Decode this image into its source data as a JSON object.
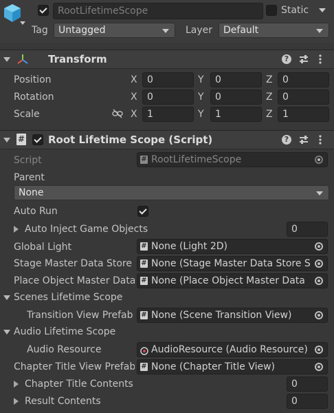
{
  "gameobject": {
    "active": true,
    "name": "RootLifetimeScope",
    "static_label": "Static",
    "static": false,
    "tag_label": "Tag",
    "tag_value": "Untagged",
    "layer_label": "Layer",
    "layer_value": "Default"
  },
  "transform": {
    "title": "Transform",
    "rows": [
      {
        "label": "Position",
        "x": "0",
        "y": "0",
        "z": "0"
      },
      {
        "label": "Rotation",
        "x": "0",
        "y": "0",
        "z": "0"
      },
      {
        "label": "Scale",
        "x": "1",
        "y": "1",
        "z": "1"
      }
    ],
    "axis": {
      "x": "X",
      "y": "Y",
      "z": "Z"
    }
  },
  "script_component": {
    "title": "Root Lifetime Scope (Script)",
    "enabled": true,
    "script_label": "Script",
    "script_value": "RootLifetimeScope",
    "parent_label": "Parent",
    "parent_value": "None",
    "auto_run_label": "Auto Run",
    "auto_run": true,
    "auto_inject_label": "Auto Inject Game Objects",
    "auto_inject_count": "0",
    "global_light_label": "Global Light",
    "global_light_value": "None (Light 2D)",
    "stage_master_label": "Stage Master Data Store",
    "stage_master_value": "None (Stage Master Data Store S",
    "place_object_label": "Place Object Master Data",
    "place_object_value": "None (Place Object Master Data",
    "scenes_scope_label": "Scenes Lifetime Scope",
    "transition_view_label": "Transition View Prefab",
    "transition_view_value": "None (Scene Transition View)",
    "audio_scope_label": "Audio Lifetime Scope",
    "audio_resource_label": "Audio Resource",
    "audio_resource_value": "AudioResource (Audio Resource)",
    "chapter_title_view_label": "Chapter Title View Prefab",
    "chapter_title_view_value": "None (Chapter Title View)",
    "chapter_contents_label": "Chapter Title Contents",
    "chapter_contents_count": "0",
    "result_contents_label": "Result Contents",
    "result_contents_count": "0"
  },
  "icons": [
    "cube-icon",
    "transform-axes-icon",
    "script-icon",
    "help-icon",
    "presets-icon",
    "kebab-menu-icon",
    "link-icon",
    "object-picker-icon"
  ]
}
